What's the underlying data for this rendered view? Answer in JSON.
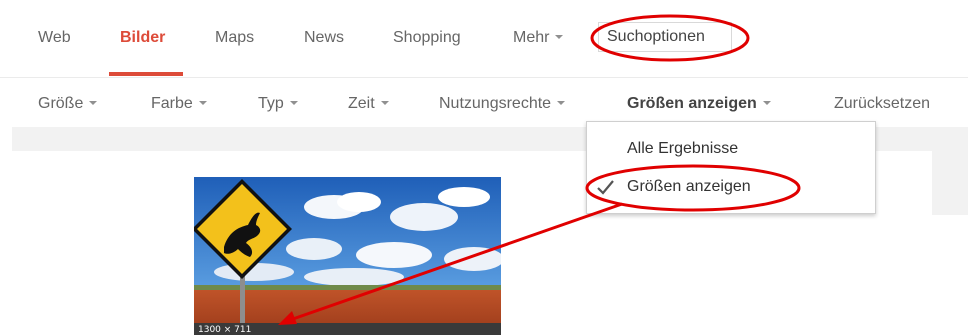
{
  "nav": {
    "tabs": [
      {
        "label": "Web"
      },
      {
        "label": "Bilder",
        "active": true
      },
      {
        "label": "Maps"
      },
      {
        "label": "News"
      },
      {
        "label": "Shopping"
      },
      {
        "label": "Mehr"
      }
    ],
    "search_options_label": "Suchoptionen"
  },
  "filters": [
    {
      "label": "Größe"
    },
    {
      "label": "Farbe"
    },
    {
      "label": "Typ"
    },
    {
      "label": "Zeit"
    },
    {
      "label": "Nutzungsrechte"
    },
    {
      "label": "Größen anzeigen",
      "selected": true
    },
    {
      "label": "Zurücksetzen"
    }
  ],
  "dropdown": {
    "items": [
      {
        "label": "Alle Ergebnisse",
        "checked": false
      },
      {
        "label": "Größen anzeigen",
        "checked": true
      }
    ]
  },
  "thumbnail": {
    "size_label": "1300 × 711"
  },
  "colors": {
    "accent": "#dd4b39",
    "annotation": "#e00000"
  }
}
